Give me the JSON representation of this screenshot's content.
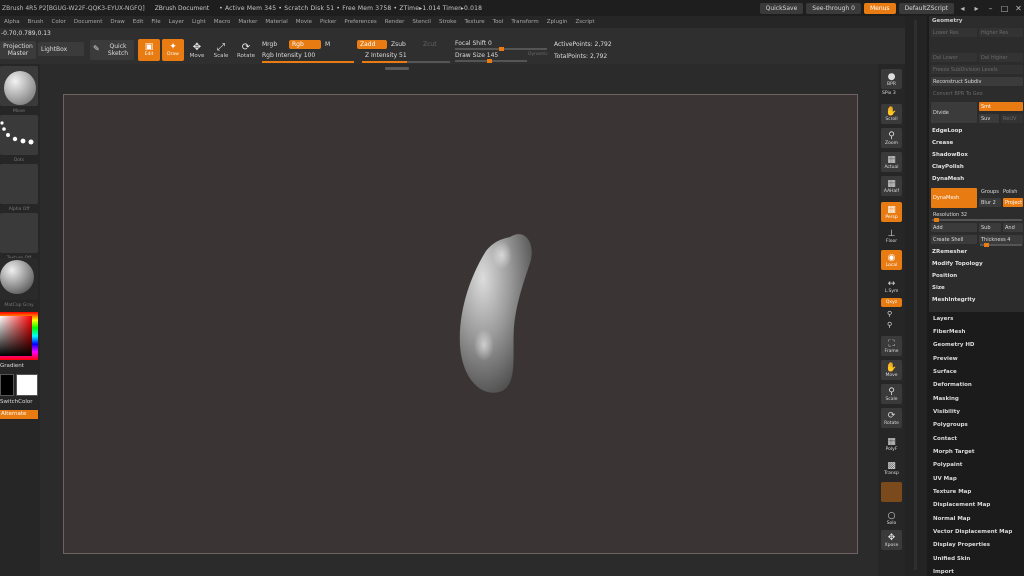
{
  "titlebar": {
    "app": "ZBrush 4R5 P2[BGUG-W22F-QQK3-EYUX-NGFQ]",
    "document": "ZBrush Document",
    "stats": "• Active Mem 345 • Scratch Disk 51 • Free Mem 3758 • ZTime▸1.014 Timer▸0.018",
    "quicksave": "QuickSave",
    "seethrough": "See-through  0",
    "menus": "Menus",
    "script": "DefaultZScript",
    "win_controls": [
      "◂",
      "▸",
      "–",
      "□",
      "✕"
    ]
  },
  "menubar": [
    "Alpha",
    "Brush",
    "Color",
    "Document",
    "Draw",
    "Edit",
    "File",
    "Layer",
    "Light",
    "Macro",
    "Marker",
    "Material",
    "Movie",
    "Picker",
    "Preferences",
    "Render",
    "Stencil",
    "Stroke",
    "Texture",
    "Tool",
    "Transform",
    "Zplugin",
    "Zscript"
  ],
  "toolbar": {
    "coords": "-0.70,0.789,0.13",
    "projection_master": "Projection Master",
    "lightbox": "LightBox",
    "quick_sketch": "Quick Sketch",
    "edit": "Edit",
    "draw": "Draw",
    "move": "Move",
    "scale": "Scale",
    "rotate": "Rotate",
    "mrgb": "Mrgb",
    "rgb": "Rgb",
    "m": "M",
    "zadd": "Zadd",
    "zsub": "Zsub",
    "zcut": "Zcut",
    "rgb_intensity": "Rgb Intensity 100",
    "z_intensity": "Z Intensity 51",
    "focal_shift": "Focal Shift 0",
    "draw_size": "Draw Size 145",
    "dynamic": "Dynamic",
    "active_points": "ActivePoints: 2,792",
    "total_points": "TotalPoints: 2,792",
    "rgb_intensity_value": 100,
    "z_intensity_value": 51
  },
  "leftshelf": {
    "brush_caption": "Move",
    "stroke_caption": "Dots",
    "alpha_caption": "Alpha Off",
    "texture_caption": "Texture Off",
    "material_caption": "MatCap Gray",
    "gradient": "Gradient",
    "switch_color": "SwitchColor",
    "alternate": "Alternate",
    "main_color": "#ffffff",
    "secondary_color": "#000000"
  },
  "rightshelf": [
    {
      "name": "bpr-button",
      "label": "BPR",
      "icon": "sphere-icon",
      "on": false
    },
    {
      "name": "spix-label",
      "label": "SPix 3",
      "icon": "",
      "on": false
    },
    {
      "name": "scroll-button",
      "label": "Scroll",
      "icon": "hand-icon",
      "on": false
    },
    {
      "name": "zoom-button",
      "label": "Zoom",
      "icon": "magnifier-icon",
      "on": false
    },
    {
      "name": "actual-button",
      "label": "Actual",
      "icon": "actual-icon",
      "on": false
    },
    {
      "name": "aahalf-button",
      "label": "AAHalf",
      "icon": "aahalf-icon",
      "on": false
    },
    {
      "name": "persp-button",
      "label": "Persp",
      "icon": "grid-icon",
      "on": true
    },
    {
      "name": "floor-button",
      "label": "Floor",
      "icon": "floor-icon",
      "on": false
    },
    {
      "name": "local-button",
      "label": "Local",
      "icon": "local-icon",
      "on": true
    },
    {
      "name": "lsym-button",
      "label": "L.Sym",
      "icon": "sym-icon",
      "on": false
    },
    {
      "name": "qxyz-button",
      "label": "Qxyz",
      "icon": "",
      "on": true
    },
    {
      "name": "frame-button",
      "label": "Frame",
      "icon": "frame-icon",
      "on": false
    },
    {
      "name": "move-button",
      "label": "Move",
      "icon": "hand-icon",
      "on": false
    },
    {
      "name": "scale-button",
      "label": "Scale",
      "icon": "scale-icon",
      "on": false
    },
    {
      "name": "rotate-button",
      "label": "Rotate",
      "icon": "rotate-icon",
      "on": false
    },
    {
      "name": "polyf-button",
      "label": "PolyF",
      "icon": "grid-icon",
      "on": false
    },
    {
      "name": "transp-button",
      "label": "Transp",
      "icon": "transp-icon",
      "on": false
    },
    {
      "name": "ghost-button",
      "label": "",
      "icon": "ghost-icon",
      "on": true
    },
    {
      "name": "solo-button",
      "label": "Solo",
      "icon": "solo-icon",
      "on": false
    },
    {
      "name": "xpose-button",
      "label": "Xpose",
      "icon": "xpose-icon",
      "on": false
    }
  ],
  "palette": {
    "header": "Geometry",
    "lower_res": "Lower Res",
    "higher_res": "Higher Res",
    "del_lower": "Del Lower",
    "del_higher": "Del Higher",
    "freeze_subdiv": "Freeze SubDivision Levels",
    "reconstruct_subdiv": "Reconstruct Subdiv",
    "convert_bpr": "Convert BPR To Geo",
    "divide": "Divide",
    "smt": "Smt",
    "suv": "Suv",
    "reuv": "ReUV",
    "edgeloop": "EdgeLoop",
    "crease": "Crease",
    "shadowbox": "ShadowBox",
    "claypolish": "ClayPolish",
    "dynamesh_section": "DynaMesh",
    "dynamesh_btn": "DynaMesh",
    "groups": "Groups",
    "polish": "Polish",
    "blur": "Blur 2",
    "project": "Project",
    "resolution": "Resolution 32",
    "add": "Add",
    "sub": "Sub",
    "and": "And",
    "create_shell": "Create Shell",
    "thickness": "Thickness 4",
    "zremesher": "ZRemesher",
    "modify_topology": "Modify Topology",
    "position": "Position",
    "size": "Size",
    "meshintegrity": "MeshIntegrity",
    "categories": [
      "Layers",
      "FiberMesh",
      "Geometry HD",
      "Preview",
      "Surface",
      "Deformation",
      "Masking",
      "Visibility",
      "Polygroups",
      "Contact",
      "Morph Target",
      "Polypaint",
      "UV Map",
      "Texture Map",
      "Displacement Map",
      "Normal Map",
      "Vector Displacement Map",
      "Display Properties",
      "Unified Skin",
      "Import"
    ]
  },
  "colors": {
    "accent": "#e87b12",
    "canvas": "#3a3435",
    "panel": "#2c2c2c"
  }
}
